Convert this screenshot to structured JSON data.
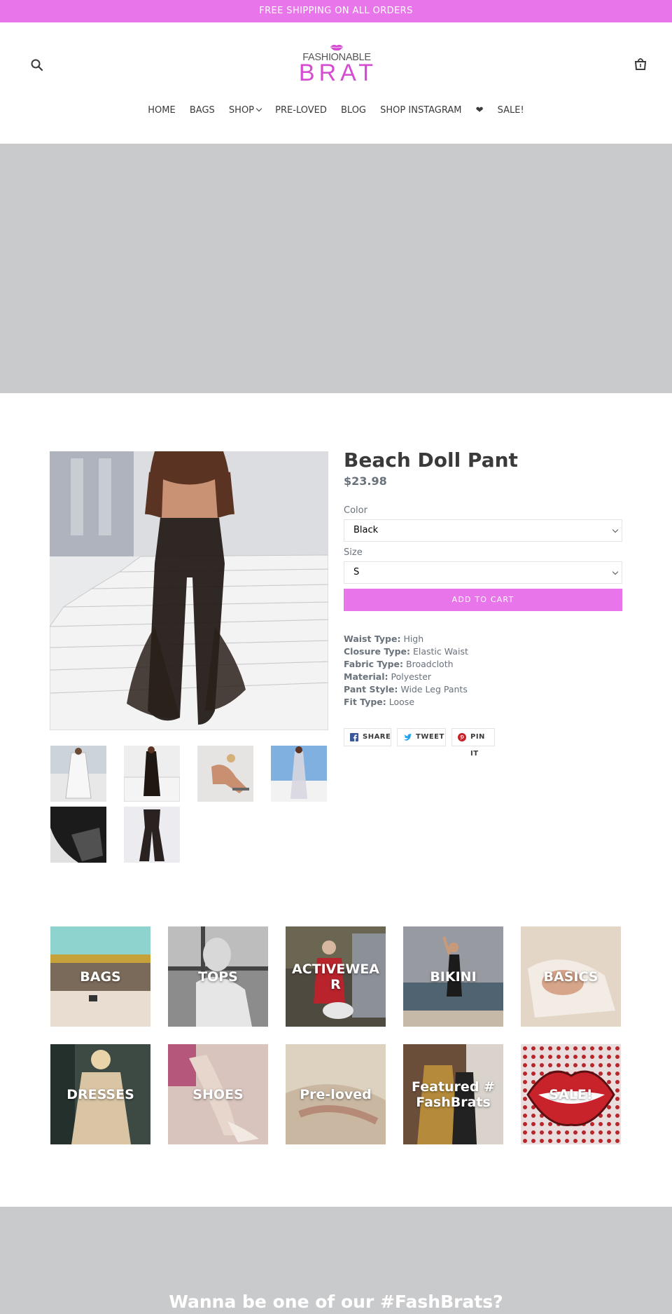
{
  "announcement": "FREE SHIPPING ON ALL ORDERS",
  "logo": {
    "top": "FASHIONABLE",
    "bottom": "BRAT"
  },
  "nav": [
    "HOME",
    "BAGS",
    "SHOP",
    "PRE-LOVED",
    "BLOG",
    "SHOP INSTAGRAM",
    "❤",
    "SALE!"
  ],
  "product": {
    "title": "Beach Doll Pant",
    "price": "$23.98",
    "color_label": "Color",
    "color_value": "Black",
    "size_label": "Size",
    "size_value": "S",
    "add_to_cart": "ADD TO CART",
    "specs": [
      {
        "k": "Waist Type:",
        "v": "High"
      },
      {
        "k": "Closure Type:",
        "v": "Elastic Waist"
      },
      {
        "k": "Fabric Type:",
        "v": "Broadcloth"
      },
      {
        "k": "Material:",
        "v": "Polyester"
      },
      {
        "k": "Pant Style:",
        "v": "Wide Leg Pants"
      },
      {
        "k": "Fit Type:",
        "v": "Loose"
      }
    ],
    "share": {
      "facebook": "SHARE",
      "twitter": "TWEET",
      "pinterest": "PIN IT"
    }
  },
  "collections": [
    "BAGS",
    "TOPS",
    "ACTIVEWEAR",
    "BIKINI",
    "BASICS",
    "DRESSES",
    "SHOES",
    "Pre-loved",
    "Featured #FashBrats",
    "SALE!"
  ],
  "footer": {
    "heading": "Wanna be one of our #FashBrats?"
  },
  "colors": {
    "accent": "#e876ea",
    "logo": "#d54bd2",
    "hero": "#c9cacc"
  }
}
